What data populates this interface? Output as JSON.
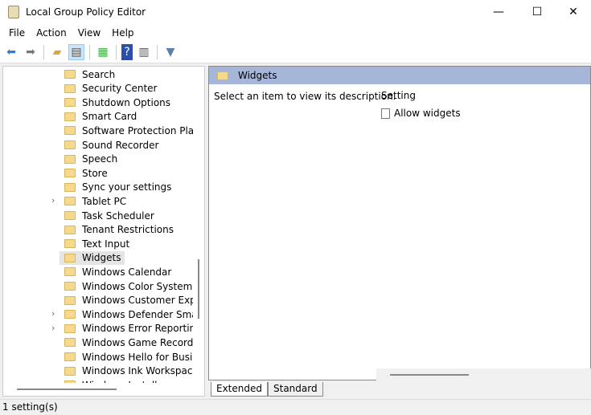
{
  "window": {
    "title": "Local Group Policy Editor",
    "minimize": "—",
    "maximize": "☐",
    "close": "✕"
  },
  "menu": [
    "File",
    "Action",
    "View",
    "Help"
  ],
  "toolbar": [
    "back-icon",
    "forward-icon",
    "up-folder-icon",
    "show-hide-tree-icon",
    "export-list-icon",
    "help-icon",
    "show-hide-action-pane-icon",
    "filter-icon"
  ],
  "tree": [
    {
      "label": "Search"
    },
    {
      "label": "Security Center"
    },
    {
      "label": "Shutdown Options"
    },
    {
      "label": "Smart Card"
    },
    {
      "label": "Software Protection Platform"
    },
    {
      "label": "Sound Recorder"
    },
    {
      "label": "Speech"
    },
    {
      "label": "Store"
    },
    {
      "label": "Sync your settings"
    },
    {
      "label": "Tablet PC",
      "expandable": true
    },
    {
      "label": "Task Scheduler"
    },
    {
      "label": "Tenant Restrictions"
    },
    {
      "label": "Text Input"
    },
    {
      "label": "Widgets",
      "selected": true
    },
    {
      "label": "Windows Calendar"
    },
    {
      "label": "Windows Color System"
    },
    {
      "label": "Windows Customer Experience Improvement Program"
    },
    {
      "label": "Windows Defender SmartScreen",
      "expandable": true
    },
    {
      "label": "Windows Error Reporting",
      "expandable": true
    },
    {
      "label": "Windows Game Recording and Broadcasting"
    },
    {
      "label": "Windows Hello for Business"
    },
    {
      "label": "Windows Ink Workspace"
    },
    {
      "label": "Windows Installer"
    }
  ],
  "right": {
    "header": "Widgets",
    "description": "Select an item to view its description.",
    "column": "Setting",
    "settings": [
      "Allow widgets"
    ]
  },
  "tabs": [
    "Extended",
    "Standard"
  ],
  "status": "1 setting(s)"
}
